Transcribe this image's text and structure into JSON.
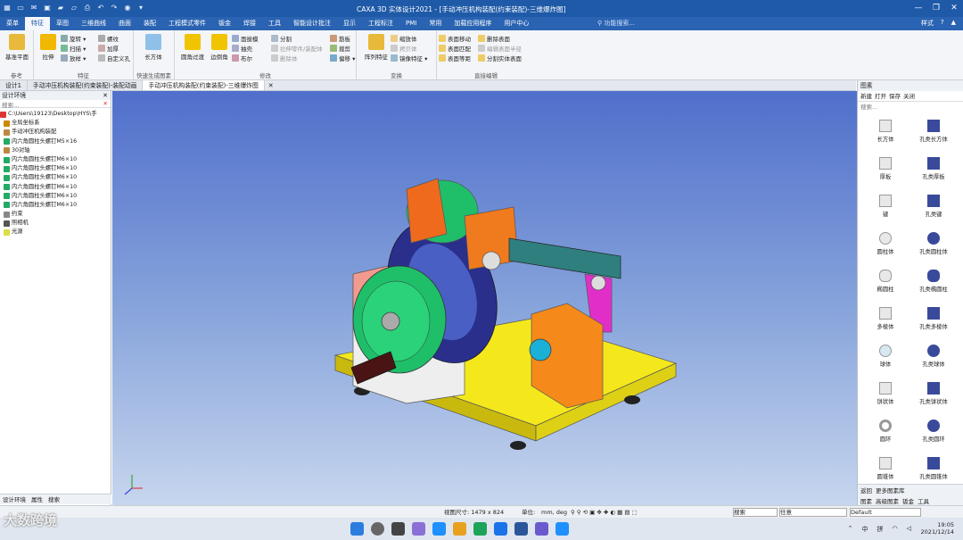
{
  "title_bar": {
    "title": "CAXA 3D 实体设计2021 - [手动冲压机构装配(约束装配)-三维爆炸图]",
    "quick_access": [
      "grid-icon",
      "new-icon",
      "mail-icon",
      "save-icon",
      "folder-icon",
      "folder-open-icon",
      "print-icon",
      "undo-icon",
      "redo-icon",
      "help-icon",
      "dropdown-icon"
    ],
    "window_buttons": [
      "—",
      "❐",
      "✕"
    ]
  },
  "menu": {
    "items": [
      "菜单",
      "特征",
      "草图",
      "三维曲线",
      "曲面",
      "装配",
      "工程模式零件",
      "钣金",
      "焊接",
      "工具",
      "智能设计批注",
      "显示",
      "工程标注",
      "PMI",
      "常用",
      "加载应用程序",
      "用户中心"
    ],
    "active": "特征",
    "search_placeholder": "功能搜索...",
    "style_label": "样式"
  },
  "ribbon": {
    "groups": [
      {
        "label": "参考",
        "big": [
          "基准平面"
        ]
      },
      {
        "label": "特征",
        "big": [
          "拉伸"
        ],
        "small": [
          "旋转 ▾",
          "扫描 ▾",
          "放样 ▾",
          "螺纹",
          "加厚",
          "自定义孔"
        ]
      },
      {
        "label": "快速生成图素",
        "big": [
          "长方体"
        ]
      },
      {
        "label": "修改",
        "big": [
          "圆角过渡",
          "边倒角"
        ],
        "small": [
          "面拔模",
          "抽壳",
          "布尔",
          "分割",
          "拉伸零件/装配体",
          "删除体"
        ]
      },
      {
        "label": "变换",
        "big": [
          "阵列特征"
        ],
        "small": [
          "筋板",
          "裁剪",
          "偏移 ▾",
          "缩放体",
          "拷贝体",
          "镜像特征 ▾"
        ]
      },
      {
        "label": "直接编辑",
        "small": [
          "表面移动",
          "表面匹配",
          "表面等距",
          "删除表面",
          "编辑表面半径",
          "分割实体表面"
        ]
      }
    ]
  },
  "doc_tabs": [
    "设计1",
    "手动冲压机构装配(约束装配)-装配动画",
    "手动冲压机构装配(约束装配)-三维爆炸图"
  ],
  "doc_tab_active": 2,
  "left_panel": {
    "header": "设计环境",
    "search_placeholder": "搜索...",
    "tree": [
      "C:\\Users\\19123\\Desktop\\HYS\\手",
      "全局坐标系",
      "手动冲压机构装配",
      "内六角圆柱头螺钉M5×16",
      "30对轴",
      "内六角圆柱头螺钉M6×10",
      "内六角圆柱头螺钉M6×10",
      "内六角圆柱头螺钉M6×10",
      "内六角圆柱头螺钉M6×10",
      "内六角圆柱头螺钉M6×10",
      "内六角圆柱头螺钉M6×10",
      "约束",
      "照相机",
      "光源"
    ],
    "bottom_tabs": [
      "设计环境",
      "属性",
      "搜索"
    ]
  },
  "right_panel": {
    "header": "图素",
    "tools": [
      "新建",
      "打开",
      "保存",
      "关闭"
    ],
    "search_placeholder": "搜索...",
    "shapes": [
      "长方体",
      "孔类长方体",
      "厚板",
      "孔类厚板",
      "键",
      "孔类键",
      "圆柱体",
      "孔类圆柱体",
      "椭圆柱",
      "孔类椭圆柱",
      "多棱体",
      "孔类多棱体",
      "球体",
      "孔类球体",
      "饼状体",
      "孔类饼状体",
      "圆环",
      "孔类圆环",
      "圆锥体",
      "孔类圆锥体"
    ],
    "nav": [
      "返回",
      "更多图素库"
    ],
    "bottom_tabs": [
      "图素",
      "高级图素",
      "钣金",
      "工具"
    ]
  },
  "status_bar": {
    "viewport_size": "视图尺寸: 1479 x 824",
    "units_label": "单位:",
    "units_value": "mm, deg",
    "select_mode": "任意",
    "style": "Default",
    "search_placeholder": "搜索"
  },
  "taskbar": {
    "time": "19:05",
    "date": "2021/12/14",
    "ime": "中",
    "lang": "拼"
  },
  "watermark": "大数跨境",
  "colors": {
    "titlebar": "#1f5aa8",
    "menubar": "#2a63b2",
    "viewport_top": "#4f6fcb",
    "base_plate": "#f1e51c",
    "green_wheel": "#1fbf6a",
    "navy_disc": "#2a2f8c",
    "orange_part": "#f07a1e",
    "teal_link": "#2f7f7f",
    "magenta_arm": "#e22ec8"
  }
}
